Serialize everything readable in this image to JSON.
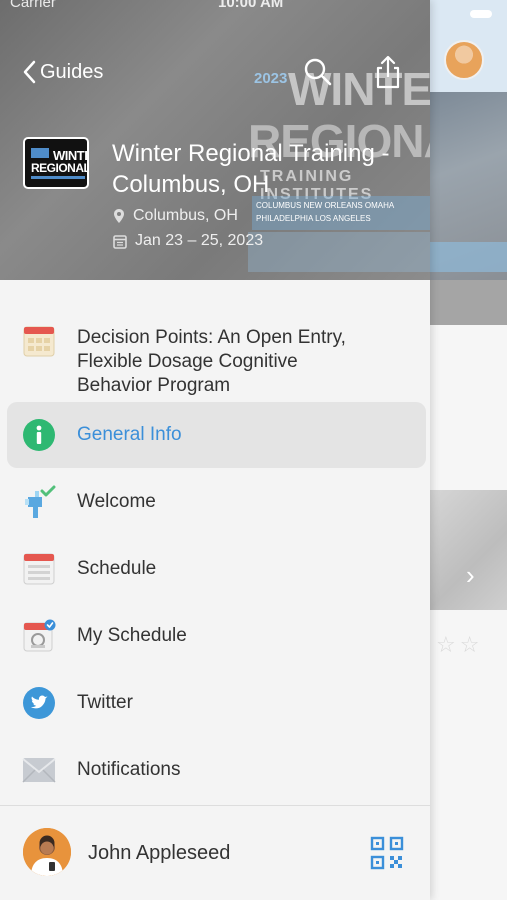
{
  "status_bar": {
    "carrier": "Carrier",
    "time": "10:00 AM"
  },
  "header": {
    "back_label": "Guides",
    "hero": {
      "year": "2023",
      "word1": "WINTER",
      "word2": "REGIONAL",
      "subtitle": "TRAINING INSTITUTES",
      "cities": "COLUMBUS  NEW ORLEANS  OMAHA  PHILADELPHIA  LOS ANGELES"
    },
    "logo": {
      "line1": "WINTER",
      "line2": "REGIONAL"
    },
    "event_title": "Winter Regional Training - Columbus, OH",
    "location": "Columbus, OH",
    "dates": "Jan 23 – 25, 2023"
  },
  "menu": {
    "items": [
      {
        "label": "Decision Points: An Open Entry, Flexible Dosage Cognitive Behavior Program",
        "icon": "calendar-grid-icon"
      },
      {
        "label": "General Info",
        "icon": "info-icon",
        "active": true
      },
      {
        "label": "Welcome",
        "icon": "welcome-icon"
      },
      {
        "label": "Schedule",
        "icon": "schedule-list-icon"
      },
      {
        "label": "My Schedule",
        "icon": "my-schedule-icon"
      },
      {
        "label": "Twitter",
        "icon": "twitter-icon"
      },
      {
        "label": "Notifications",
        "icon": "envelope-icon"
      }
    ]
  },
  "footer": {
    "user_name": "John Appleseed",
    "qr_icon": "qr-code-icon"
  },
  "colors": {
    "accent": "#3b8fd9",
    "active_bg": "#e4e4e4",
    "info_green": "#2eb872",
    "calendar_red": "#e5574f",
    "twitter_blue": "#3d97d8"
  }
}
